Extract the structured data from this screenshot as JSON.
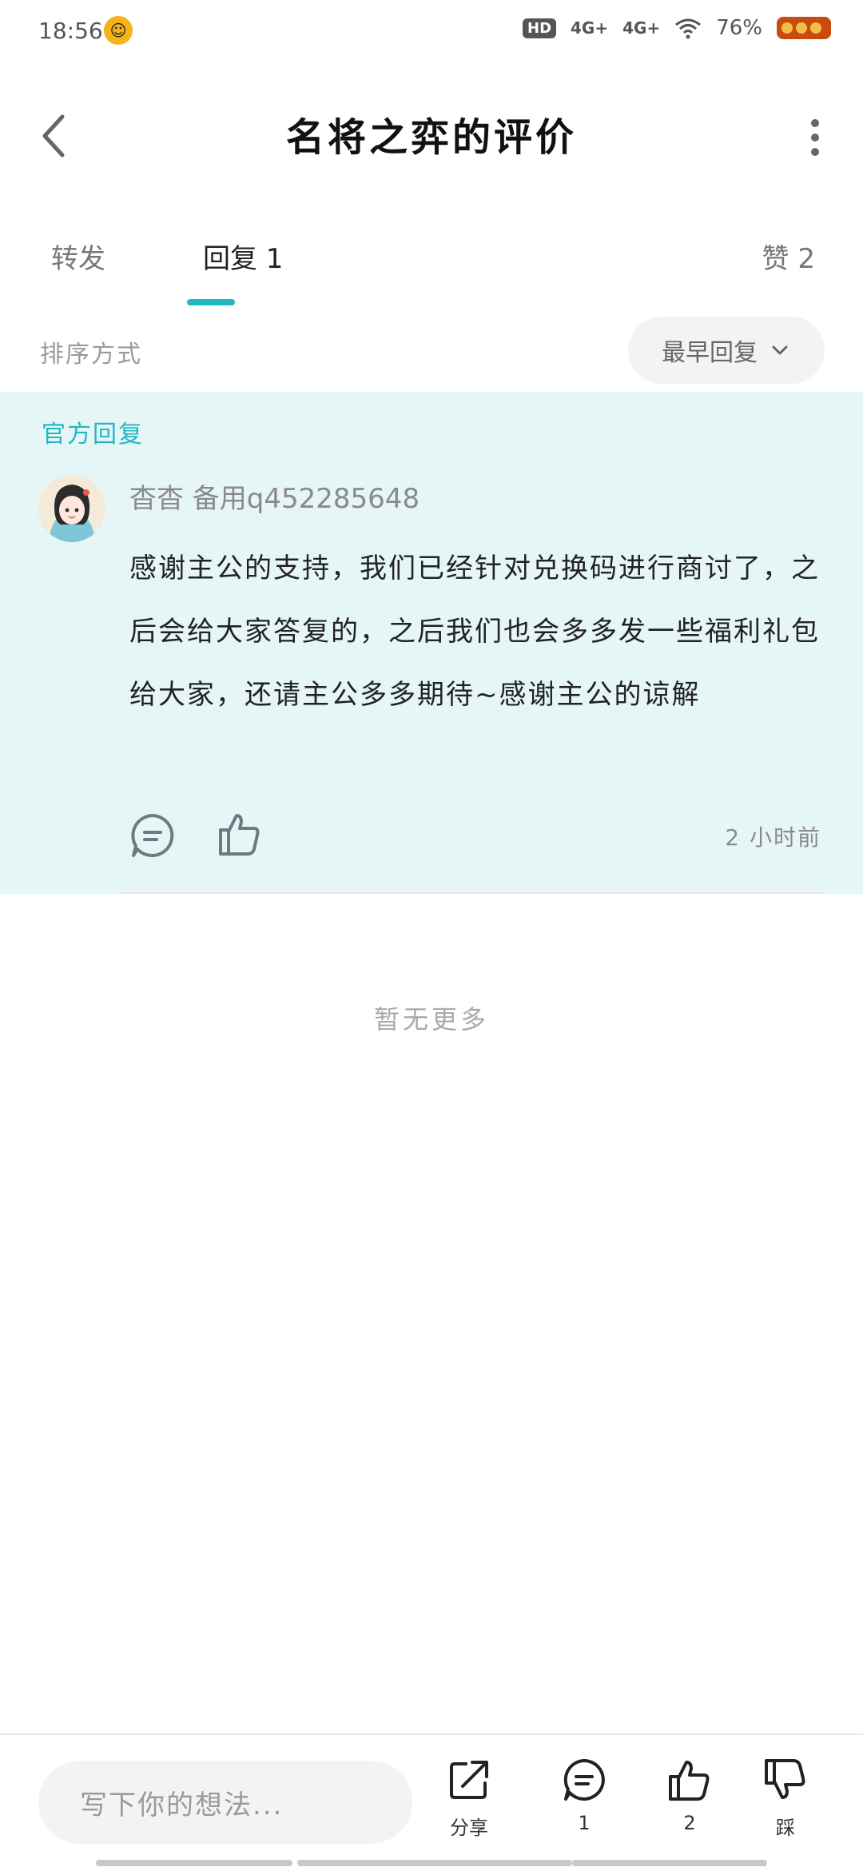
{
  "status_bar": {
    "time": "18:56",
    "hd_label": "HD",
    "network1": "4G+",
    "network2": "4G+",
    "battery_text": "76%"
  },
  "header": {
    "title": "名将之弈的评价"
  },
  "tabs": [
    {
      "label": "转发"
    },
    {
      "label": "回复 1"
    },
    {
      "label": "赞 2"
    }
  ],
  "sort": {
    "label": "排序方式",
    "selected": "最早回复"
  },
  "official_reply": {
    "tag": "官方回复",
    "username": "杳杳 备用q452285648",
    "text": "感谢主公的支持，我们已经针对兑换码进行商讨了，之后会给大家答复的，之后我们也会多多发一些福利礼包给大家，还请主公多多期待~感谢主公的谅解",
    "time": "2 小时前"
  },
  "footer_note": "暂无更多",
  "bottom_bar": {
    "input_placeholder": "写下你的想法...",
    "share_label": "分享",
    "reply_count": "1",
    "like_count": "2",
    "dislike_label": "踩"
  },
  "colors": {
    "accent": "#1fb8c3",
    "official_bg": "#e6f6f7"
  }
}
